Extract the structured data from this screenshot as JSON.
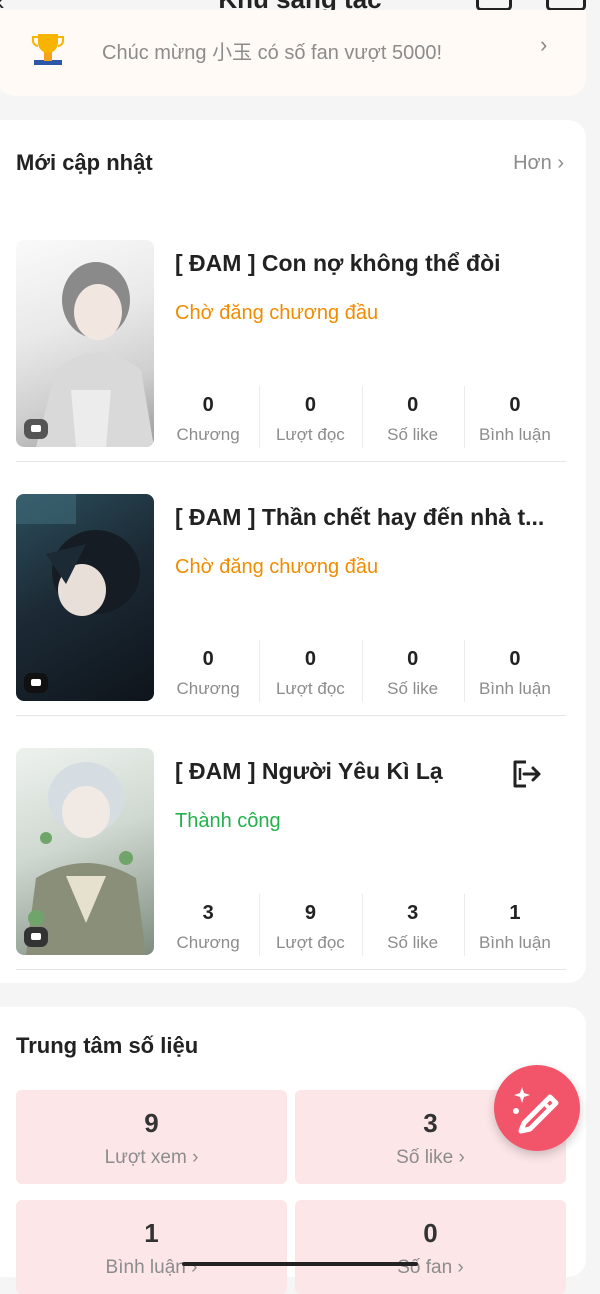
{
  "header": {
    "title": "Khu sáng tác",
    "back_glyph": "‹"
  },
  "notice": {
    "text": "Chúc mừng 小玉 có số fan vượt 5000!",
    "arrow": "›"
  },
  "recent": {
    "title": "Mới cập nhật",
    "more_label": "Hơn ›",
    "works": [
      {
        "title": "[ ĐAM ] Con nợ không thể đòi",
        "status": "Chờ đăng chương đầu",
        "stats": [
          {
            "value": "0",
            "label": "Chương"
          },
          {
            "value": "0",
            "label": "Lượt đọc"
          },
          {
            "value": "0",
            "label": "Số like"
          },
          {
            "value": "0",
            "label": "Bình luận"
          }
        ]
      },
      {
        "title": "[ ĐAM ] Thần chết hay đến nhà t...",
        "status": "Chờ đăng chương đầu",
        "stats": [
          {
            "value": "0",
            "label": "Chương"
          },
          {
            "value": "0",
            "label": "Lượt đọc"
          },
          {
            "value": "0",
            "label": "Số like"
          },
          {
            "value": "0",
            "label": "Bình luận"
          }
        ]
      },
      {
        "title": "[ ĐAM ] Người Yêu Kì Lạ",
        "status": "Thành công",
        "stats": [
          {
            "value": "3",
            "label": "Chương"
          },
          {
            "value": "9",
            "label": "Lượt đọc"
          },
          {
            "value": "3",
            "label": "Số like"
          },
          {
            "value": "1",
            "label": "Bình luận"
          }
        ]
      }
    ]
  },
  "data_center": {
    "title": "Trung tâm số liệu",
    "tiles": [
      {
        "value": "9",
        "label": "Lượt xem ›"
      },
      {
        "value": "3",
        "label": "Số like ›"
      },
      {
        "value": "1",
        "label": "Bình luận ›"
      },
      {
        "value": "0",
        "label": "Số fan ›"
      }
    ]
  },
  "colors": {
    "accent": "#f25569",
    "status_waiting": "#f08c00",
    "status_success": "#22b14c",
    "tile_bg": "#fde6e8"
  },
  "icons": [
    "back-icon",
    "trophy-icon",
    "chevron-right-icon",
    "comment-badge-icon",
    "exit-icon",
    "edit-wand-icon"
  ]
}
